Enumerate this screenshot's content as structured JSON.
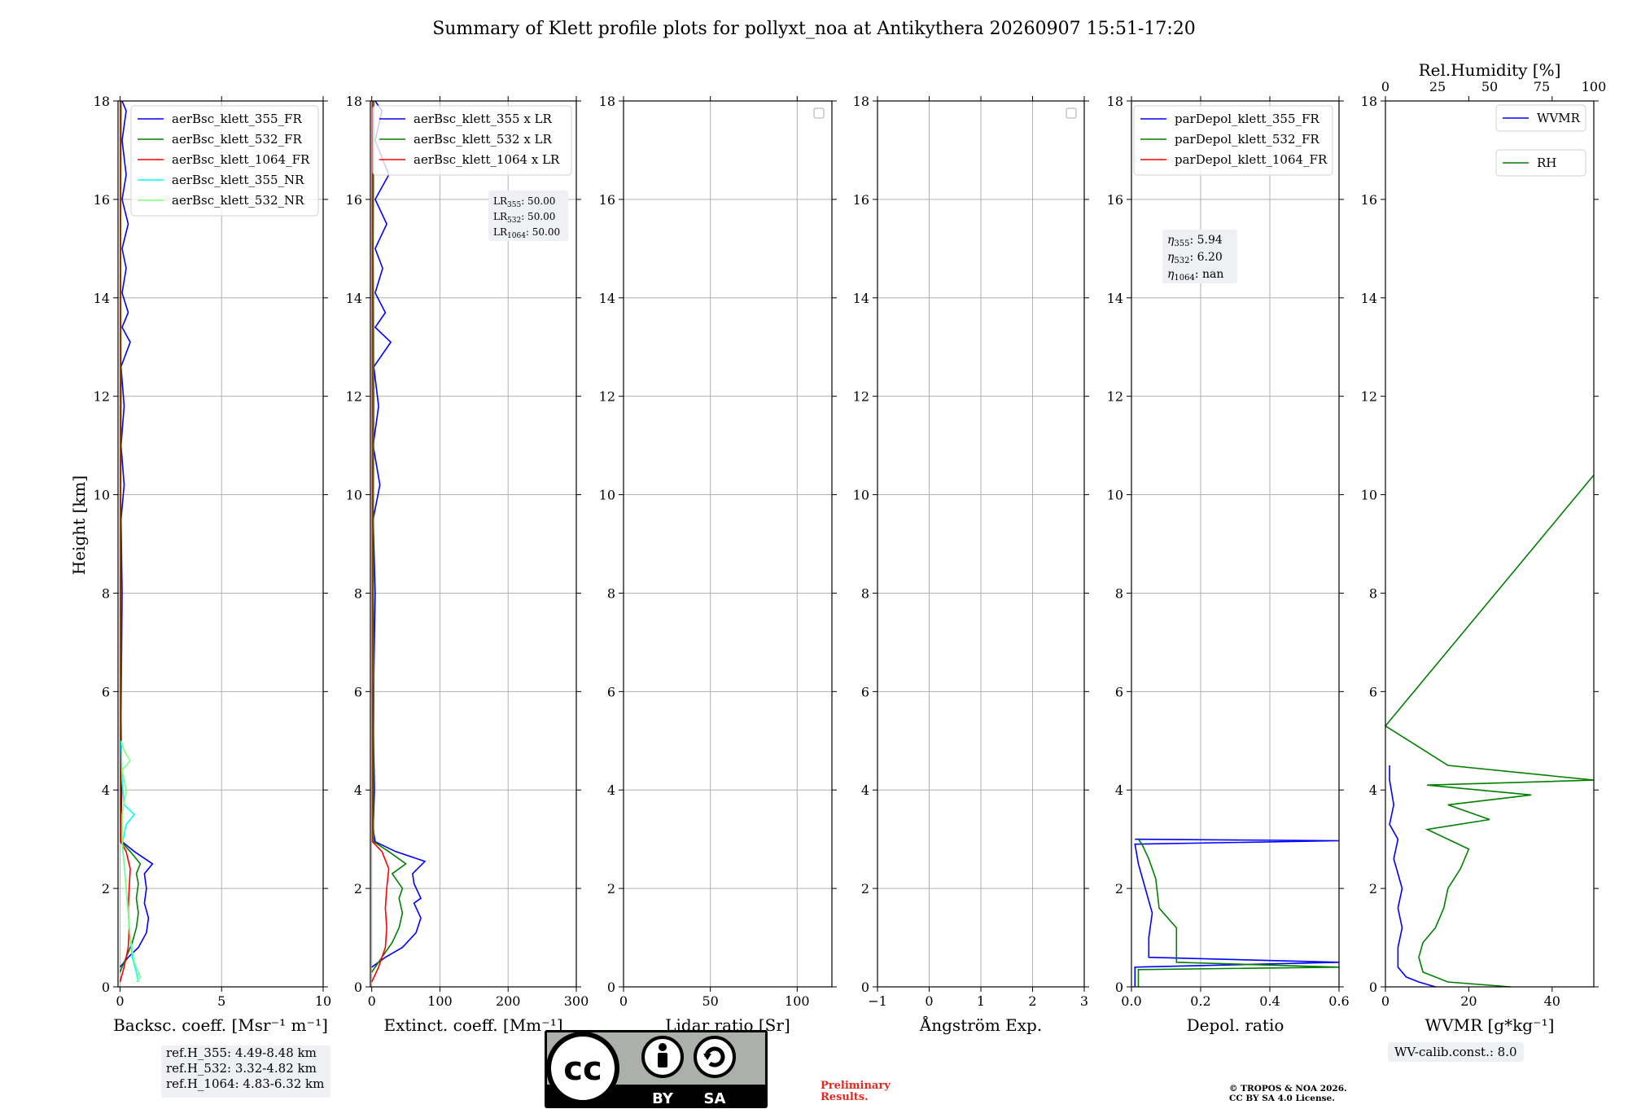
{
  "figure_title": "Summary of Klett profile plots for pollyxt_noa at Antikythera 20260907 15:51-17:20",
  "ylabel": "Height [km]",
  "ref_heights": [
    "ref.H_355: 4.49-8.48 km",
    "ref.H_532: 3.32-4.82 km",
    "ref.H_1064: 4.83-6.32 km"
  ],
  "wv_calib": "WV-calib.const.: 8.0",
  "preliminary": [
    "Preliminary",
    "Results."
  ],
  "copyright": [
    "© TROPOS & NOA 2026.",
    "CC BY SA 4.0 License."
  ],
  "license_badge": {
    "by": "BY",
    "sa": "SA"
  },
  "lr_box": [
    {
      "sub": "355",
      "val": "50.00"
    },
    {
      "sub": "532",
      "val": "50.00"
    },
    {
      "sub": "1064",
      "val": "50.00"
    }
  ],
  "eta_box": [
    {
      "sub": "355",
      "val": "5.94"
    },
    {
      "sub": "532",
      "val": "6.20"
    },
    {
      "sub": "1064",
      "val": "nan"
    }
  ],
  "colors": {
    "blue": "#0000ff",
    "green": "#008000",
    "red": "#ff0000",
    "cyan": "#00ffff",
    "lightgreen": "#80ff80",
    "grid": "#b0b0b0"
  },
  "chart_data": [
    {
      "type": "line",
      "xlabel": "Backsc. coeff. [Msr⁻¹ m⁻¹]",
      "xlim": [
        -0.1,
        10
      ],
      "xticks": [
        0,
        5,
        10
      ],
      "ylim": [
        0,
        18
      ],
      "yticks": [
        0,
        2,
        4,
        6,
        8,
        10,
        12,
        14,
        16,
        18
      ],
      "grid": true,
      "legend_position": "top-right",
      "series": [
        {
          "name": "aerBsc_klett_355_FR",
          "color": "#0000ff",
          "points": [
            [
              0,
              0.4
            ],
            [
              0.4,
              0.6
            ],
            [
              0.9,
              0.8
            ],
            [
              1.3,
              1.1
            ],
            [
              1.4,
              1.4
            ],
            [
              1.2,
              1.7
            ],
            [
              1.3,
              2.0
            ],
            [
              1.2,
              2.3
            ],
            [
              1.6,
              2.5
            ],
            [
              0.7,
              2.75
            ],
            [
              0.1,
              2.95
            ],
            [
              0.05,
              3.2
            ],
            [
              0.08,
              4.0
            ],
            [
              0.05,
              5.5
            ],
            [
              0.1,
              8.0
            ],
            [
              0.05,
              9.5
            ],
            [
              0.2,
              10.2
            ],
            [
              0.05,
              11.0
            ],
            [
              0.2,
              11.8
            ],
            [
              0.05,
              12.6
            ],
            [
              0.5,
              13.1
            ],
            [
              0.1,
              13.4
            ],
            [
              0.4,
              13.7
            ],
            [
              0.1,
              14.1
            ],
            [
              0.3,
              14.6
            ],
            [
              0.1,
              15.0
            ],
            [
              0.4,
              15.5
            ],
            [
              0.1,
              16.0
            ],
            [
              0.3,
              16.5
            ],
            [
              0.1,
              17.2
            ],
            [
              0.3,
              17.8
            ],
            [
              0.1,
              18.0
            ]
          ]
        },
        {
          "name": "aerBsc_klett_532_FR",
          "color": "#008000",
          "points": [
            [
              0,
              0.3
            ],
            [
              0.3,
              0.6
            ],
            [
              0.6,
              0.9
            ],
            [
              0.8,
              1.2
            ],
            [
              0.9,
              1.5
            ],
            [
              0.8,
              1.8
            ],
            [
              0.9,
              2.1
            ],
            [
              0.8,
              2.3
            ],
            [
              1.0,
              2.5
            ],
            [
              0.5,
              2.75
            ],
            [
              0.05,
              2.95
            ],
            [
              0.03,
              3.5
            ],
            [
              0.05,
              6.0
            ],
            [
              0.03,
              9.0
            ],
            [
              0.05,
              12.0
            ],
            [
              0.03,
              15.0
            ],
            [
              0.05,
              18.0
            ]
          ]
        },
        {
          "name": "aerBsc_klett_1064_FR",
          "color": "#ff0000",
          "points": [
            [
              0,
              0.1
            ],
            [
              0.2,
              0.4
            ],
            [
              0.4,
              0.8
            ],
            [
              0.45,
              1.2
            ],
            [
              0.4,
              1.6
            ],
            [
              0.45,
              2.0
            ],
            [
              0.5,
              2.4
            ],
            [
              0.3,
              2.75
            ],
            [
              0.02,
              2.95
            ],
            [
              0.01,
              5.0
            ],
            [
              0.01,
              10.0
            ],
            [
              0.01,
              18.0
            ]
          ]
        },
        {
          "name": "aerBsc_klett_355_NR",
          "color": "#00ffff",
          "points": [
            [
              0.9,
              0.1
            ],
            [
              0.8,
              0.3
            ],
            [
              0.6,
              0.6
            ],
            [
              0.5,
              1.0
            ],
            [
              0.4,
              1.5
            ],
            [
              0.3,
              2.0
            ],
            [
              0.2,
              2.5
            ],
            [
              0.1,
              2.9
            ],
            [
              0.3,
              3.3
            ],
            [
              0.7,
              3.5
            ],
            [
              0.2,
              3.7
            ],
            [
              0.1,
              4.2
            ],
            [
              0.05,
              5.0
            ]
          ]
        },
        {
          "name": "aerBsc_klett_532_NR",
          "color": "#80ff80",
          "points": [
            [
              0.8,
              0.1
            ],
            [
              1.0,
              0.2
            ],
            [
              0.7,
              0.5
            ],
            [
              0.5,
              1.0
            ],
            [
              0.4,
              1.5
            ],
            [
              0.3,
              2.0
            ],
            [
              0.2,
              2.5
            ],
            [
              0.1,
              3.0
            ],
            [
              0.1,
              3.5
            ],
            [
              0.3,
              4.0
            ],
            [
              0.1,
              4.4
            ],
            [
              0.5,
              4.6
            ],
            [
              0.2,
              4.8
            ],
            [
              0.05,
              5.0
            ]
          ]
        }
      ]
    },
    {
      "type": "line",
      "xlabel": "Extinct. coeff. [Mm⁻¹]",
      "xlim": [
        -2,
        300
      ],
      "xticks": [
        0,
        100,
        200,
        300
      ],
      "ylim": [
        0,
        18
      ],
      "yticks": [
        0,
        2,
        4,
        6,
        8,
        10,
        12,
        14,
        16,
        18
      ],
      "grid": true,
      "legend_position": "top-right",
      "series": [
        {
          "name": "aerBsc_klett_355 x LR",
          "color": "#0000ff",
          "points": [
            [
              0,
              0.4
            ],
            [
              20,
              0.6
            ],
            [
              45,
              0.8
            ],
            [
              65,
              1.1
            ],
            [
              72,
              1.4
            ],
            [
              62,
              1.7
            ],
            [
              72,
              1.8
            ],
            [
              62,
              2.1
            ],
            [
              60,
              2.3
            ],
            [
              78,
              2.55
            ],
            [
              35,
              2.75
            ],
            [
              5,
              2.95
            ],
            [
              2,
              3.2
            ],
            [
              4,
              4.0
            ],
            [
              2,
              5.5
            ],
            [
              5,
              8.0
            ],
            [
              2,
              9.5
            ],
            [
              12,
              10.2
            ],
            [
              2,
              11.0
            ],
            [
              10,
              11.8
            ],
            [
              3,
              12.6
            ],
            [
              28,
              13.1
            ],
            [
              5,
              13.4
            ],
            [
              20,
              13.7
            ],
            [
              5,
              14.1
            ],
            [
              16,
              14.6
            ],
            [
              5,
              15.0
            ],
            [
              22,
              15.5
            ],
            [
              5,
              16.0
            ],
            [
              25,
              16.5
            ],
            [
              5,
              17.2
            ],
            [
              15,
              17.8
            ],
            [
              5,
              18.0
            ]
          ]
        },
        {
          "name": "aerBsc_klett_532 x LR",
          "color": "#008000",
          "points": [
            [
              0,
              0.3
            ],
            [
              15,
              0.6
            ],
            [
              30,
              0.9
            ],
            [
              40,
              1.2
            ],
            [
              45,
              1.5
            ],
            [
              40,
              1.8
            ],
            [
              45,
              2.0
            ],
            [
              30,
              2.3
            ],
            [
              50,
              2.5
            ],
            [
              25,
              2.75
            ],
            [
              3,
              2.95
            ],
            [
              2,
              3.5
            ],
            [
              3,
              6.0
            ],
            [
              2,
              9.0
            ],
            [
              3,
              12.0
            ],
            [
              2,
              15.0
            ],
            [
              3,
              18.0
            ]
          ]
        },
        {
          "name": "aerBsc_klett_1064 x LR",
          "color": "#ff0000",
          "points": [
            [
              0,
              0.1
            ],
            [
              10,
              0.4
            ],
            [
              20,
              0.8
            ],
            [
              22,
              1.2
            ],
            [
              20,
              1.6
            ],
            [
              22,
              2.0
            ],
            [
              25,
              2.4
            ],
            [
              15,
              2.75
            ],
            [
              1,
              2.95
            ],
            [
              1,
              5.0
            ],
            [
              1,
              10.0
            ],
            [
              1,
              18.0
            ]
          ]
        }
      ]
    },
    {
      "type": "line",
      "xlabel": "Lidar ratio [Sr]",
      "xlim": [
        0,
        120
      ],
      "xticks": [
        0,
        50,
        100
      ],
      "ylim": [
        0,
        18
      ],
      "yticks": [
        0,
        2,
        4,
        6,
        8,
        10,
        12,
        14,
        16,
        18
      ],
      "grid": true,
      "legend_position": "top-right",
      "series": []
    },
    {
      "type": "line",
      "xlabel": "Ångström Exp.",
      "xlim": [
        -1,
        3
      ],
      "xticks": [
        -1,
        0,
        1,
        2,
        3
      ],
      "ylim": [
        0,
        18
      ],
      "yticks": [
        0,
        2,
        4,
        6,
        8,
        10,
        12,
        14,
        16,
        18
      ],
      "grid": true,
      "legend_position": "top-right",
      "series": []
    },
    {
      "type": "line",
      "xlabel": "Depol. ratio",
      "xlim": [
        0,
        0.6
      ],
      "xticks": [
        0.0,
        0.2,
        0.4,
        0.6
      ],
      "ylim": [
        0,
        18
      ],
      "yticks": [
        0,
        2,
        4,
        6,
        8,
        10,
        12,
        14,
        16,
        18
      ],
      "grid": true,
      "legend_position": "top-left",
      "series": [
        {
          "name": "parDepol_klett_355_FR",
          "color": "#0000ff",
          "points": [
            [
              0.01,
              0.0
            ],
            [
              0.01,
              0.4
            ],
            [
              0.6,
              0.5
            ],
            [
              0.05,
              0.6
            ],
            [
              0.05,
              1.0
            ],
            [
              0.06,
              1.5
            ],
            [
              0.04,
              2.0
            ],
            [
              0.02,
              2.5
            ],
            [
              0.01,
              2.9
            ],
            [
              0.6,
              2.97
            ],
            [
              0.01,
              3.0
            ]
          ]
        },
        {
          "name": "parDepol_klett_532_FR",
          "color": "#008000",
          "points": [
            [
              0.02,
              0.0
            ],
            [
              0.02,
              0.35
            ],
            [
              0.6,
              0.4
            ],
            [
              0.13,
              0.5
            ],
            [
              0.13,
              1.2
            ],
            [
              0.08,
              1.6
            ],
            [
              0.07,
              2.2
            ],
            [
              0.05,
              2.6
            ],
            [
              0.03,
              2.9
            ],
            [
              0.02,
              3.0
            ]
          ]
        },
        {
          "name": "parDepol_klett_1064_FR",
          "color": "#ff0000",
          "points": []
        }
      ]
    },
    {
      "type": "line",
      "xlabel": "WVMR [g*kg⁻¹]",
      "x2label": "Rel.Humidity [%]",
      "xlim": [
        0,
        50
      ],
      "xticks": [
        0,
        20,
        40
      ],
      "x2lim": [
        0,
        100
      ],
      "x2ticks": [
        0,
        25,
        50,
        75,
        100
      ],
      "ylim": [
        0,
        18
      ],
      "yticks": [
        0,
        2,
        4,
        6,
        8,
        10,
        12,
        14,
        16,
        18
      ],
      "grid": false,
      "legend_position": "top-right",
      "series": [
        {
          "name": "WVMR",
          "color": "#0000ff",
          "points": [
            [
              12,
              0.0
            ],
            [
              8,
              0.1
            ],
            [
              5,
              0.2
            ],
            [
              3,
              0.4
            ],
            [
              3,
              0.8
            ],
            [
              4,
              1.2
            ],
            [
              3,
              1.6
            ],
            [
              4,
              2.0
            ],
            [
              3,
              2.3
            ],
            [
              2,
              2.6
            ],
            [
              3,
              3.0
            ],
            [
              1,
              3.3
            ],
            [
              2,
              3.7
            ],
            [
              1,
              4.2
            ],
            [
              1,
              4.5
            ]
          ]
        },
        {
          "name": "RH",
          "color": "#008000",
          "points": [
            [
              60,
              0.0
            ],
            [
              30,
              0.1
            ],
            [
              18,
              0.3
            ],
            [
              16,
              0.6
            ],
            [
              18,
              0.9
            ],
            [
              24,
              1.2
            ],
            [
              28,
              1.6
            ],
            [
              30,
              2.0
            ],
            [
              36,
              2.4
            ],
            [
              40,
              2.8
            ],
            [
              20,
              3.2
            ],
            [
              50,
              3.4
            ],
            [
              30,
              3.7
            ],
            [
              70,
              3.9
            ],
            [
              20,
              4.1
            ],
            [
              100,
              4.2
            ],
            [
              30,
              4.5
            ],
            [
              0,
              5.3
            ],
            [
              100,
              10.4
            ]
          ]
        }
      ]
    }
  ],
  "legends": [
    [
      "aerBsc_klett_355_FR",
      "aerBsc_klett_532_FR",
      "aerBsc_klett_1064_FR",
      "aerBsc_klett_355_NR",
      "aerBsc_klett_532_NR"
    ],
    [
      "aerBsc_klett_355 x LR",
      "aerBsc_klett_532 x LR",
      "aerBsc_klett_1064 x LR"
    ],
    [],
    [],
    [
      "parDepol_klett_355_FR",
      "parDepol_klett_532_FR",
      "parDepol_klett_1064_FR"
    ],
    [
      "WVMR",
      "RH"
    ]
  ]
}
